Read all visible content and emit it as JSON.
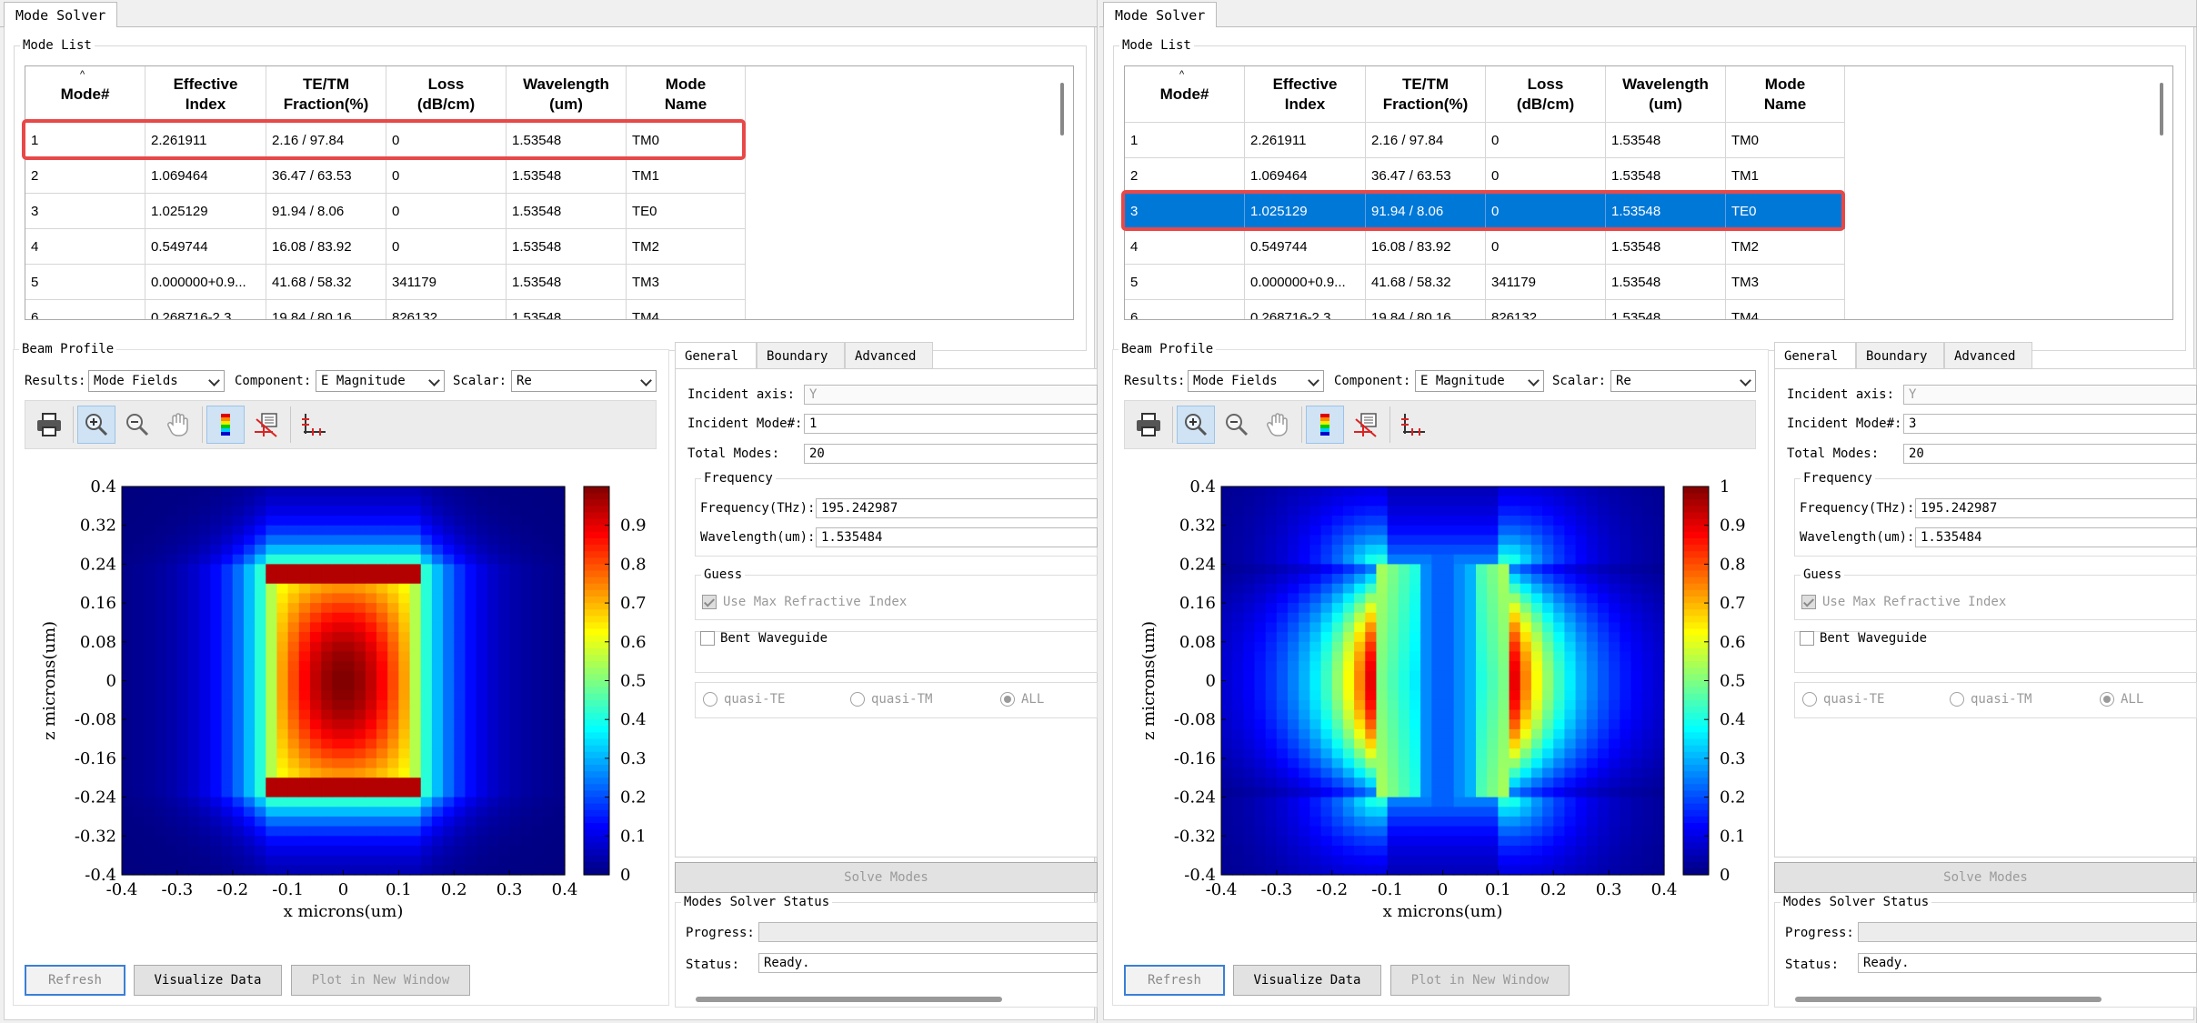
{
  "app": {
    "tab_label": "Mode Solver"
  },
  "mode_list": {
    "title": "Mode List",
    "sort_indicator": "^",
    "headers": [
      "Mode#",
      "Effective\nIndex",
      "TE/TM\nFraction(%)",
      "Loss\n(dB/cm)",
      "Wavelength\n(um)",
      "Mode\nName"
    ],
    "rows": [
      [
        "1",
        "2.261911",
        "2.16 / 97.84",
        "0",
        "1.53548",
        "TM0"
      ],
      [
        "2",
        "1.069464",
        "36.47 / 63.53",
        "0",
        "1.53548",
        "TM1"
      ],
      [
        "3",
        "1.025129",
        "91.94 / 8.06",
        "0",
        "1.53548",
        "TE0"
      ],
      [
        "4",
        "0.549744",
        "16.08 / 83.92",
        "0",
        "1.53548",
        "TM2"
      ],
      [
        "5",
        "0.000000+0.9...",
        "41.68 / 58.32",
        "341179",
        "1.53548",
        "TM3"
      ],
      [
        "6",
        "0.268716-2.3...",
        "19.84 / 80.16",
        "826132",
        "1.53548",
        "TM4"
      ]
    ]
  },
  "beam_profile": {
    "title": "Beam Profile",
    "results_label": "Results:",
    "results_value": "Mode Fields",
    "component_label": "Component:",
    "component_value": "E Magnitude",
    "scalar_label": "Scalar:",
    "scalar_value": "Re",
    "toolbar_icons": [
      "print-icon",
      "zoom-in-icon",
      "zoom-out-icon",
      "pan-hand-icon",
      "colormap-icon",
      "cursor-data-icon",
      "axes-icon"
    ],
    "buttons": {
      "refresh": "Refresh",
      "visualize": "Visualize Data",
      "plot_new": "Plot in New Window"
    }
  },
  "settings": {
    "tabs": [
      "General",
      "Boundary",
      "Advanced"
    ],
    "incident_axis_label": "Incident axis:",
    "incident_axis_value": "Y",
    "incident_mode_label": "Incident Mode#:",
    "total_modes_label": "Total Modes:",
    "total_modes_value": "20",
    "frequency_group": "Frequency",
    "frequency_label": "Frequency(THz):",
    "frequency_value": "195.242987",
    "wavelength_label": "Wavelength(um):",
    "wavelength_value": "1.535484",
    "guess_group": "Guess",
    "use_max_label": "Use Max Refractive Index",
    "bent_label": "Bent Waveguide",
    "radio_te": "quasi-TE",
    "radio_tm": "quasi-TM",
    "radio_all": "ALL",
    "solve_button": "Solve Modes",
    "status_group": "Modes Solver Status",
    "progress_label": "Progress:",
    "status_label": "Status:",
    "status_value": "Ready."
  },
  "colors": {
    "selection": "#0078d7",
    "highlight_box": "#e84848"
  },
  "panels": [
    {
      "highlight_row": 1,
      "selected_row": 0,
      "incident_mode_value": "1",
      "chart_data": {
        "type": "heatmap",
        "title": "",
        "xlabel": "x microns(um)",
        "ylabel": "z microns(um)",
        "xlim": [
          -0.4,
          0.4
        ],
        "ylim": [
          -0.4,
          0.4
        ],
        "x_ticks": [
          "-0.4",
          "-0.3",
          "-0.2",
          "-0.1",
          "0",
          "0.1",
          "0.2",
          "0.3",
          "0.4"
        ],
        "y_ticks": [
          "0.4",
          "0.32",
          "0.24",
          "0.16",
          "0.08",
          "0",
          "-0.08",
          "-0.16",
          "-0.24",
          "-0.32",
          "-0.4"
        ],
        "colorbar_range": [
          0,
          1
        ],
        "colorbar_ticks": [
          "0.9",
          "0.8",
          "0.7",
          "0.6",
          "0.5",
          "0.4",
          "0.3",
          "0.2",
          "0.1",
          "0"
        ],
        "colormap": "jet",
        "field_pattern": "TM0",
        "field_description": "single central lobe (peak ~1 at origin) with bright edge bands at z = +/-0.23, |x| < 0.13"
      }
    },
    {
      "highlight_row": 3,
      "selected_row": 3,
      "incident_mode_value": "3",
      "chart_data": {
        "type": "heatmap",
        "title": "",
        "xlabel": "x microns(um)",
        "ylabel": "z microns(um)",
        "xlim": [
          -0.4,
          0.4
        ],
        "ylim": [
          -0.4,
          0.4
        ],
        "x_ticks": [
          "-0.4",
          "-0.3",
          "-0.2",
          "-0.1",
          "0",
          "0.1",
          "0.2",
          "0.3",
          "0.4"
        ],
        "y_ticks": [
          "0.4",
          "0.32",
          "0.24",
          "0.16",
          "0.08",
          "0",
          "-0.08",
          "-0.16",
          "-0.24",
          "-0.32",
          "-0.4"
        ],
        "colorbar_range": [
          0,
          1
        ],
        "colorbar_ticks": [
          "1",
          "0.9",
          "0.8",
          "0.7",
          "0.6",
          "0.5",
          "0.4",
          "0.3",
          "0.2",
          "0.1",
          "0"
        ],
        "colormap": "jet",
        "field_pattern": "TE0",
        "field_description": "two lobes peaking at x = +/-0.13 (outer side of core edges), low field inside core, |z| < 0.24"
      }
    }
  ]
}
